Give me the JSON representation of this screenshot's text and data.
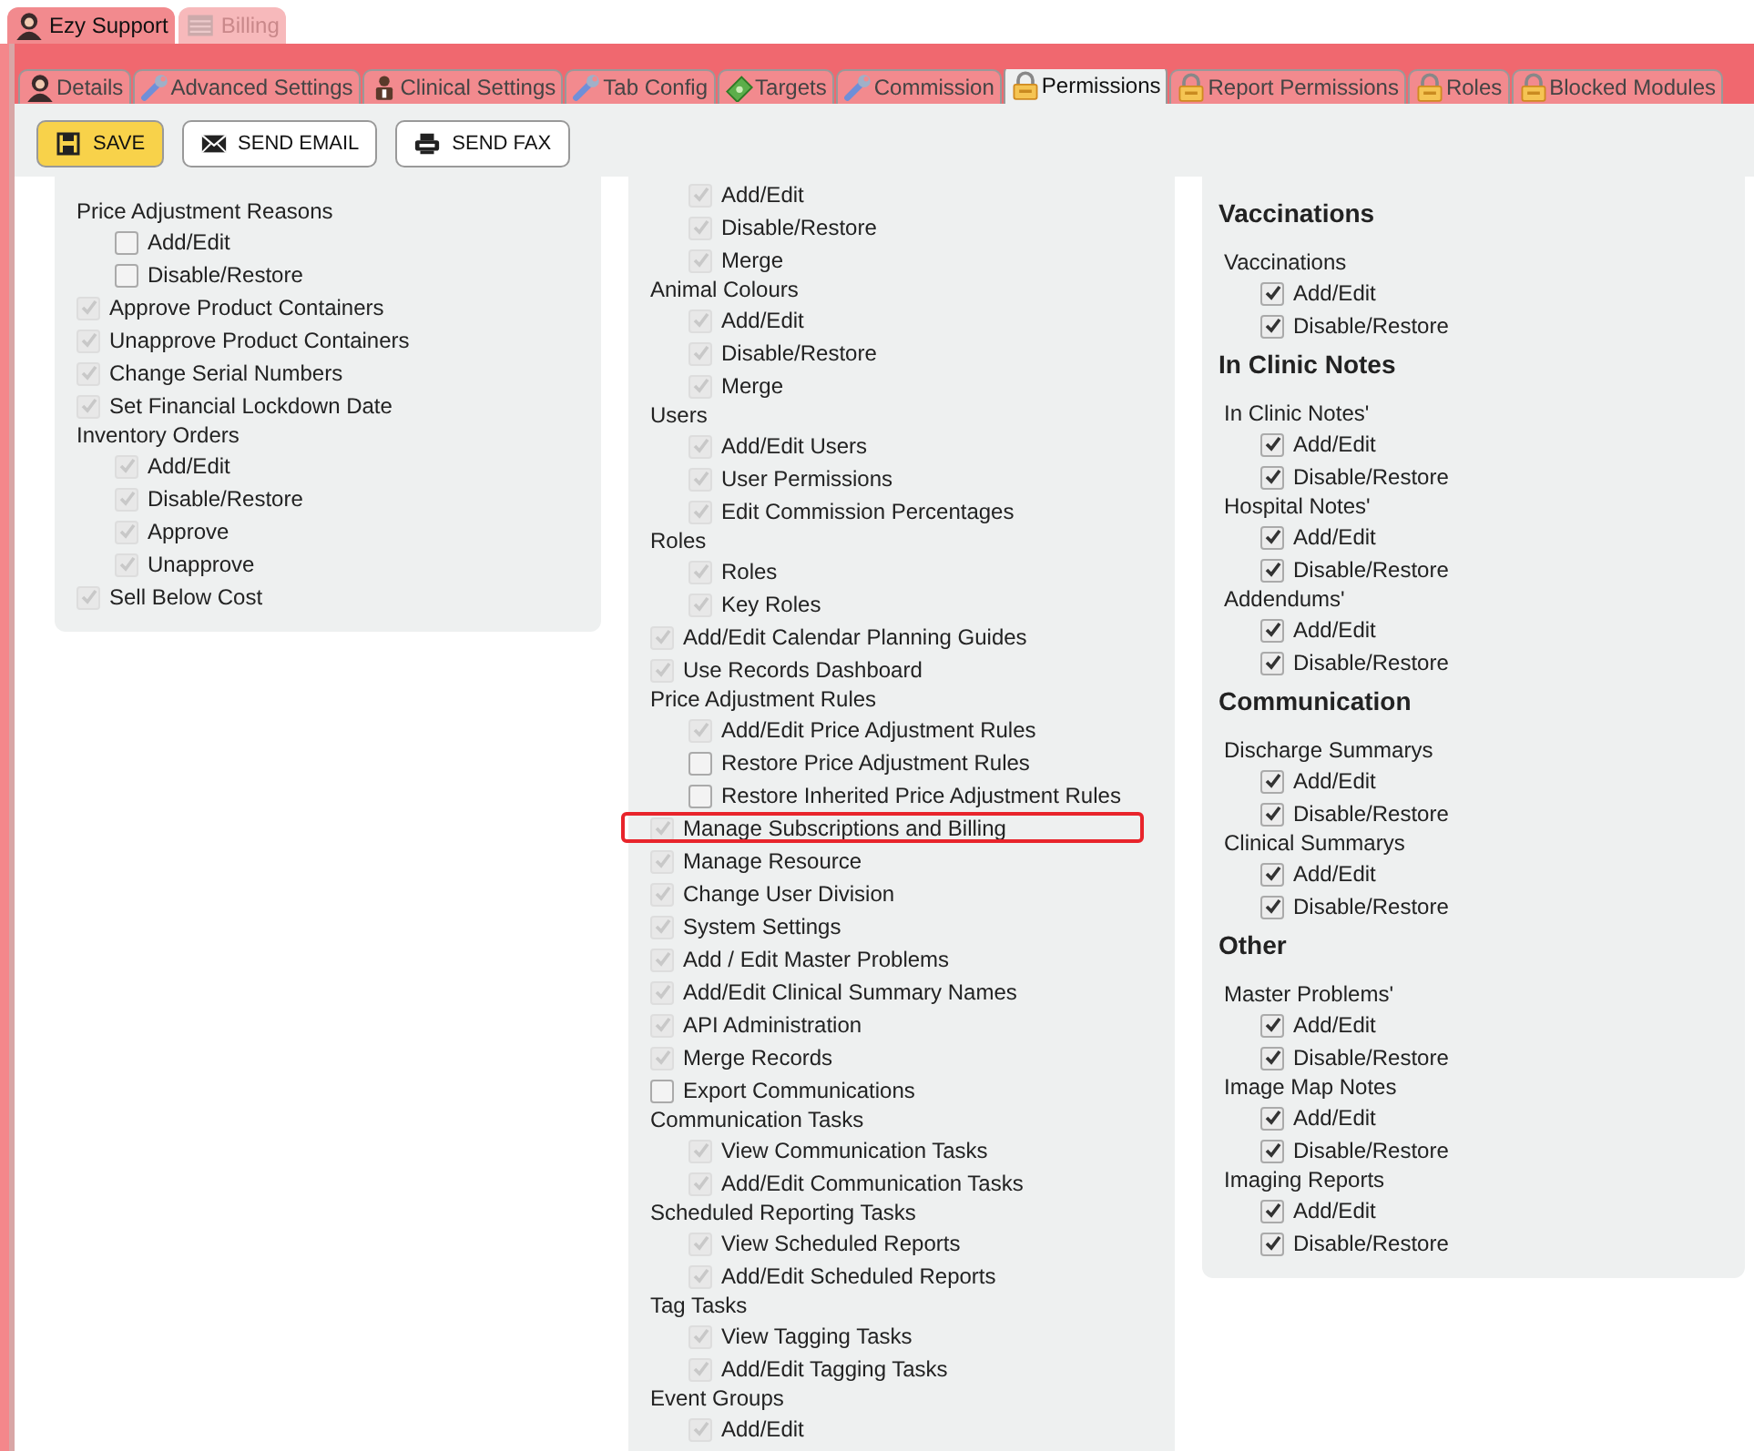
{
  "app_tabs": [
    {
      "label": "Ezy Support",
      "selected": true
    },
    {
      "label": "Billing",
      "selected": false
    }
  ],
  "tabs": [
    {
      "label": "Details",
      "selected": false
    },
    {
      "label": "Advanced Settings",
      "selected": false
    },
    {
      "label": "Clinical Settings",
      "selected": false
    },
    {
      "label": "Tab Config",
      "selected": false
    },
    {
      "label": "Targets",
      "selected": false
    },
    {
      "label": "Commission",
      "selected": false
    },
    {
      "label": "Permissions",
      "selected": true
    },
    {
      "label": "Report Permissions",
      "selected": false
    },
    {
      "label": "Roles",
      "selected": false
    },
    {
      "label": "Blocked Modules",
      "selected": false
    }
  ],
  "toolbar": [
    {
      "label": "SAVE",
      "kind": "save"
    },
    {
      "label": "SEND EMAIL",
      "kind": "email"
    },
    {
      "label": "SEND FAX",
      "kind": "fax"
    }
  ],
  "columns": [
    {
      "items": [
        {
          "kind": "group",
          "label": "Price Adjustment Reasons",
          "children": [
            {
              "label": "Add/Edit",
              "checked": false,
              "disabled": false
            },
            {
              "label": "Disable/Restore",
              "checked": false,
              "disabled": false
            }
          ]
        },
        {
          "kind": "check",
          "label": "Approve Product Containers",
          "checked": true,
          "disabled": true
        },
        {
          "kind": "check",
          "label": "Unapprove Product Containers",
          "checked": true,
          "disabled": true
        },
        {
          "kind": "check",
          "label": "Change Serial Numbers",
          "checked": true,
          "disabled": true
        },
        {
          "kind": "check",
          "label": "Set Financial Lockdown Date",
          "checked": true,
          "disabled": true
        },
        {
          "kind": "group",
          "label": "Inventory Orders",
          "children": [
            {
              "label": "Add/Edit",
              "checked": true,
              "disabled": true
            },
            {
              "label": "Disable/Restore",
              "checked": true,
              "disabled": true
            },
            {
              "label": "Approve",
              "checked": true,
              "disabled": true
            },
            {
              "label": "Unapprove",
              "checked": true,
              "disabled": true
            }
          ]
        },
        {
          "kind": "check",
          "label": "Sell Below Cost",
          "checked": true,
          "disabled": true
        }
      ]
    },
    {
      "items": [
        {
          "kind": "group",
          "children": [
            {
              "label": "Add/Edit",
              "checked": true,
              "disabled": true
            },
            {
              "label": "Disable/Restore",
              "checked": true,
              "disabled": true
            },
            {
              "label": "Merge",
              "checked": true,
              "disabled": true
            }
          ]
        },
        {
          "kind": "group",
          "label": "Animal Colours",
          "children": [
            {
              "label": "Add/Edit",
              "checked": true,
              "disabled": true
            },
            {
              "label": "Disable/Restore",
              "checked": true,
              "disabled": true
            },
            {
              "label": "Merge",
              "checked": true,
              "disabled": true
            }
          ]
        },
        {
          "kind": "group",
          "label": "Users",
          "children": [
            {
              "label": "Add/Edit Users",
              "checked": true,
              "disabled": true
            },
            {
              "label": "User Permissions",
              "checked": true,
              "disabled": true
            },
            {
              "label": "Edit Commission Percentages",
              "checked": true,
              "disabled": true
            }
          ]
        },
        {
          "kind": "group",
          "label": "Roles",
          "children": [
            {
              "label": "Roles",
              "checked": true,
              "disabled": true
            },
            {
              "label": "Key Roles",
              "checked": true,
              "disabled": true
            }
          ]
        },
        {
          "kind": "check",
          "label": "Add/Edit Calendar Planning Guides",
          "checked": true,
          "disabled": true
        },
        {
          "kind": "check",
          "label": "Use Records Dashboard",
          "checked": true,
          "disabled": true
        },
        {
          "kind": "group",
          "label": "Price Adjustment Rules",
          "children": [
            {
              "label": "Add/Edit Price Adjustment Rules",
              "checked": true,
              "disabled": true
            },
            {
              "label": "Restore Price Adjustment Rules",
              "checked": false,
              "disabled": false
            },
            {
              "label": "Restore Inherited Price Adjustment Rules",
              "checked": false,
              "disabled": false
            }
          ]
        },
        {
          "kind": "check",
          "label": "Manage Subscriptions and Billing",
          "checked": true,
          "disabled": true,
          "highlighted": true
        },
        {
          "kind": "check",
          "label": "Manage Resource",
          "checked": true,
          "disabled": true
        },
        {
          "kind": "check",
          "label": "Change User Division",
          "checked": true,
          "disabled": true
        },
        {
          "kind": "check",
          "label": "System Settings",
          "checked": true,
          "disabled": true
        },
        {
          "kind": "check",
          "label": "Add / Edit Master Problems",
          "checked": true,
          "disabled": true
        },
        {
          "kind": "check",
          "label": "Add/Edit Clinical Summary Names",
          "checked": true,
          "disabled": true
        },
        {
          "kind": "check",
          "label": "API Administration",
          "checked": true,
          "disabled": true
        },
        {
          "kind": "check",
          "label": "Merge Records",
          "checked": true,
          "disabled": true
        },
        {
          "kind": "check",
          "label": "Export Communications",
          "checked": false,
          "disabled": false
        },
        {
          "kind": "group",
          "label": "Communication Tasks",
          "children": [
            {
              "label": "View Communication Tasks",
              "checked": true,
              "disabled": true
            },
            {
              "label": "Add/Edit Communication Tasks",
              "checked": true,
              "disabled": true
            }
          ]
        },
        {
          "kind": "group",
          "label": "Scheduled Reporting Tasks",
          "children": [
            {
              "label": "View Scheduled Reports",
              "checked": true,
              "disabled": true
            },
            {
              "label": "Add/Edit Scheduled Reports",
              "checked": true,
              "disabled": true
            }
          ]
        },
        {
          "kind": "group",
          "label": "Tag Tasks",
          "children": [
            {
              "label": "View Tagging Tasks",
              "checked": true,
              "disabled": true
            },
            {
              "label": "Add/Edit Tagging Tasks",
              "checked": true,
              "disabled": true
            }
          ]
        },
        {
          "kind": "group",
          "label": "Event Groups",
          "children": [
            {
              "label": "Add/Edit",
              "checked": true,
              "disabled": true
            }
          ]
        }
      ]
    },
    {
      "items": [
        {
          "kind": "heading",
          "label": "Vaccinations"
        },
        {
          "kind": "group",
          "label": "Vaccinations",
          "children": [
            {
              "label": "Add/Edit",
              "checked": true,
              "disabled": false
            },
            {
              "label": "Disable/Restore",
              "checked": true,
              "disabled": false
            }
          ]
        },
        {
          "kind": "heading",
          "label": "In Clinic Notes"
        },
        {
          "kind": "group",
          "label": "In Clinic Notes'",
          "children": [
            {
              "label": "Add/Edit",
              "checked": true,
              "disabled": false
            },
            {
              "label": "Disable/Restore",
              "checked": true,
              "disabled": false
            }
          ]
        },
        {
          "kind": "group",
          "label": "Hospital Notes'",
          "children": [
            {
              "label": "Add/Edit",
              "checked": true,
              "disabled": false
            },
            {
              "label": "Disable/Restore",
              "checked": true,
              "disabled": false
            }
          ]
        },
        {
          "kind": "group",
          "label": "Addendums'",
          "children": [
            {
              "label": "Add/Edit",
              "checked": true,
              "disabled": false
            },
            {
              "label": "Disable/Restore",
              "checked": true,
              "disabled": false
            }
          ]
        },
        {
          "kind": "heading",
          "label": "Communication"
        },
        {
          "kind": "group",
          "label": "Discharge Summarys",
          "children": [
            {
              "label": "Add/Edit",
              "checked": true,
              "disabled": false
            },
            {
              "label": "Disable/Restore",
              "checked": true,
              "disabled": false
            }
          ]
        },
        {
          "kind": "group",
          "label": "Clinical Summarys",
          "children": [
            {
              "label": "Add/Edit",
              "checked": true,
              "disabled": false
            },
            {
              "label": "Disable/Restore",
              "checked": true,
              "disabled": false
            }
          ]
        },
        {
          "kind": "heading",
          "label": "Other"
        },
        {
          "kind": "group",
          "label": "Master Problems'",
          "children": [
            {
              "label": "Add/Edit",
              "checked": true,
              "disabled": false
            },
            {
              "label": "Disable/Restore",
              "checked": true,
              "disabled": false
            }
          ]
        },
        {
          "kind": "group",
          "label": "Image Map Notes",
          "children": [
            {
              "label": "Add/Edit",
              "checked": true,
              "disabled": false
            },
            {
              "label": "Disable/Restore",
              "checked": true,
              "disabled": false
            }
          ]
        },
        {
          "kind": "group",
          "label": "Imaging Reports",
          "children": [
            {
              "label": "Add/Edit",
              "checked": true,
              "disabled": false
            },
            {
              "label": "Disable/Restore",
              "checked": true,
              "disabled": false
            }
          ]
        }
      ]
    }
  ]
}
